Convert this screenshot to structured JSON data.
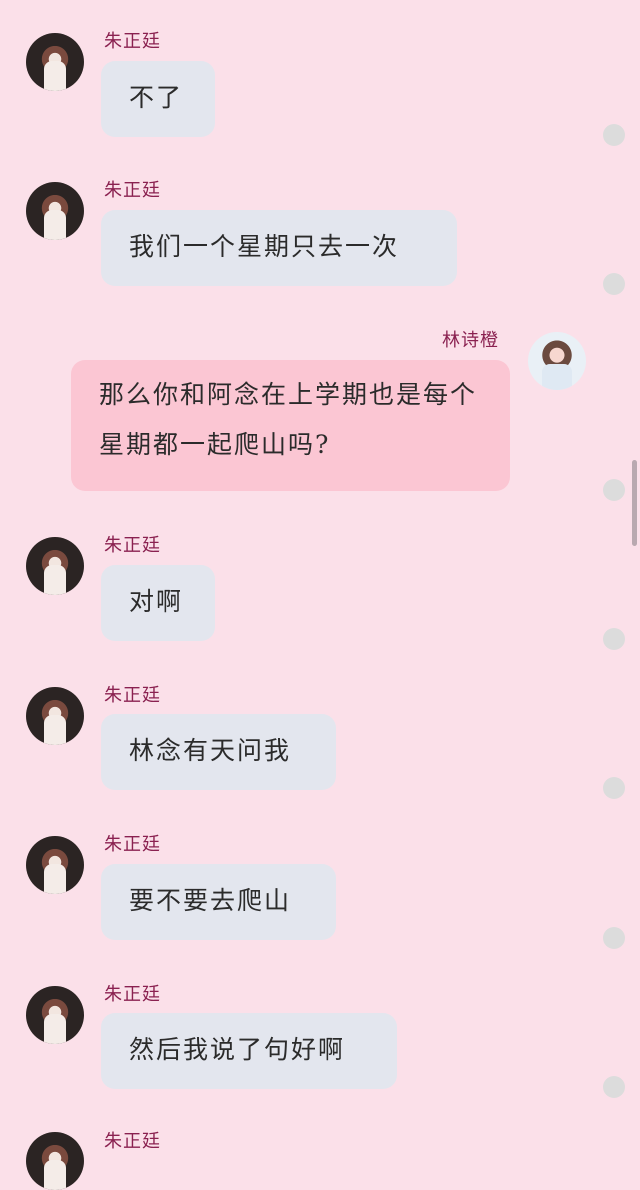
{
  "messages": [
    {
      "sender": "朱正廷",
      "text": "不了",
      "side": "left"
    },
    {
      "sender": "朱正廷",
      "text": "我们一个星期只去一次",
      "side": "left"
    },
    {
      "sender": "林诗橙",
      "text": "那么你和阿念在上学期也是每个星期都一起爬山吗?",
      "side": "right"
    },
    {
      "sender": "朱正廷",
      "text": "对啊",
      "side": "left"
    },
    {
      "sender": "朱正廷",
      "text": "林念有天问我",
      "side": "left"
    },
    {
      "sender": "朱正廷",
      "text": "要不要去爬山",
      "side": "left"
    },
    {
      "sender": "朱正廷",
      "text": "然后我说了句好啊",
      "side": "left"
    },
    {
      "sender": "朱正廷"
    }
  ],
  "colors": {
    "background": "#fbe0e9",
    "received_bubble": "#e3e6ee",
    "sent_bubble": "#fbc6d3",
    "name_text": "#8a2150"
  }
}
